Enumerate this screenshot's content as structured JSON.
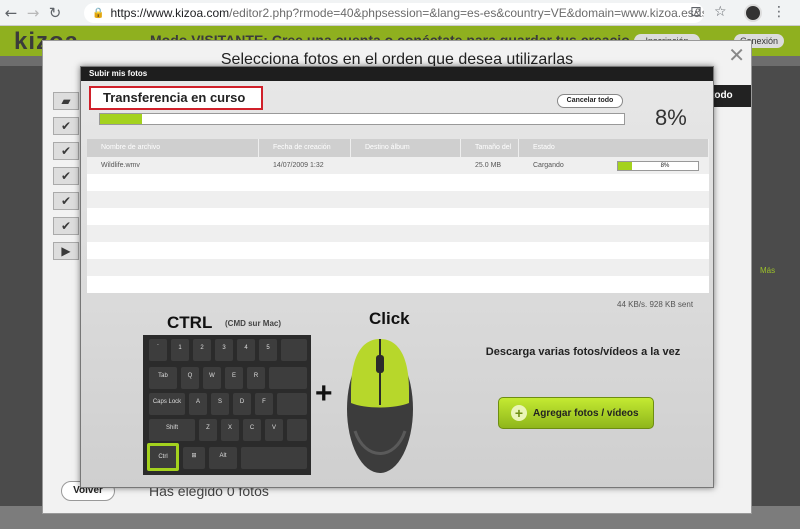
{
  "browser": {
    "url_host": "https://www.kizoa.com",
    "url_rest": "/editor2.php?rmode=40&phpsession=&lang=es-es&country=VE&domain=www.kizoa.es&st..."
  },
  "site": {
    "logo": "kizoa",
    "visitor_text": "Modo VISITANTE: Cree una cuenta o conéctate para guardar tus creacio",
    "signup_label": "Inscripción",
    "login_label": "Conexión",
    "back_label": "Volver",
    "chosen_text": "Has elegido 0 fotos",
    "all_label": "todo",
    "more_label": "Más"
  },
  "outer_dialog": {
    "title": "Selecciona fotos en el orden que desea utilizarlas",
    "close_icon": "close-icon"
  },
  "upload_dialog": {
    "header": "Subir mis fotos",
    "status": "Transferencia en curso",
    "cancel_label": "Cancelar todo",
    "progress_percent": 8,
    "progress_text": "8%",
    "columns": [
      "Nombre de archivo",
      "Fecha de creación",
      "Destino álbum",
      "Tamaño del arc",
      "Estado"
    ],
    "file": {
      "name": "Wildlife.wmv",
      "date": "14/07/2009 1:32",
      "album": "",
      "size": "25.0 MB",
      "state": "Cargando",
      "progress_text": "8%",
      "progress_percent": 8
    },
    "speed": "44 KB/s. 928 KB sent",
    "ctrl_label": "CTRL",
    "cmd_label": "(CMD sur Mac)",
    "plus": "+",
    "click_label": "Click",
    "hint": "Descarga varias fotos/vídeos a la vez",
    "add_button": "Agregar fotos / vídeos",
    "keys": {
      "tab": "Tab",
      "caps": "Caps Lock",
      "shift": "Shift",
      "ctrl": "Ctrl",
      "alt": "Alt",
      "row1": [
        "~",
        "!",
        "@",
        "#",
        "$",
        "%"
      ],
      "row1b": [
        "`",
        "1",
        "2",
        "3",
        "4",
        "5"
      ],
      "row2": [
        "Q",
        "W",
        "E",
        "R"
      ],
      "row3": [
        "A",
        "S",
        "D",
        "F"
      ],
      "row4": [
        "Z",
        "X",
        "C",
        "V"
      ]
    }
  },
  "colors": {
    "accent_green": "#a4d21e",
    "highlight_red": "#d0202a"
  }
}
